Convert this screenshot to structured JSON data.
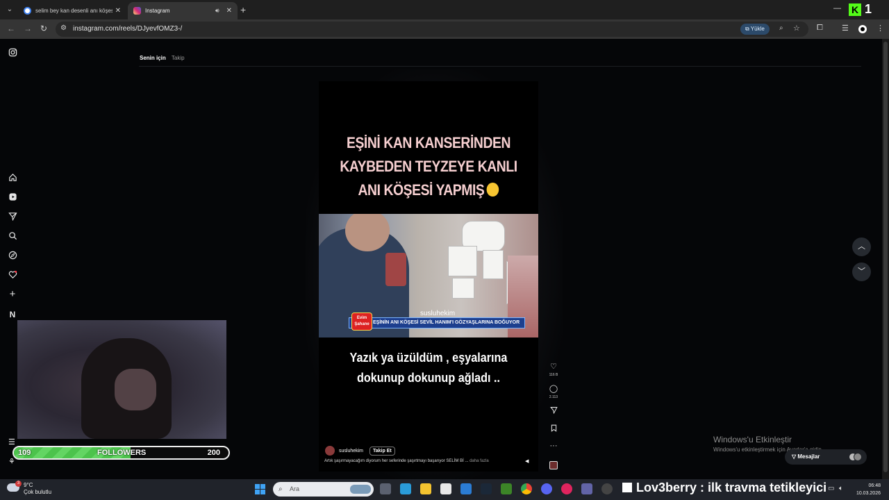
{
  "browser": {
    "tabs": [
      {
        "title": "selim bey kan desenli anı köşesi",
        "favicon_color": "#ffffff",
        "active": false
      },
      {
        "title": "Instagram",
        "favicon_color": "#d62976",
        "active": true
      }
    ],
    "url": "instagram.com/reels/DJyevfOMZ3-/",
    "upload_label": "Yükle",
    "kick_count": "1"
  },
  "feed": {
    "tab_for_you": "Senin için",
    "tab_following": "Takip"
  },
  "reel": {
    "headline_lines": [
      "EŞİNİ KAN KANSERİNDEN",
      "KAYBEDEN TEYZEYE KANLI",
      "ANI KÖŞESİ YAPMIŞ"
    ],
    "video_handle": "susluhekim",
    "evim_badge": "Evim Şahane",
    "lower_third": "EŞİNİN ANI KÖŞESİ SEVİL HANIM'I GÖZYAŞLARINA BOĞUYOR",
    "subtitle_lines": [
      "Yazık ya üzüldüm , eşyalarına",
      "dokunup dokunup ağladı .."
    ],
    "author": "susluhekim",
    "follow_label": "Takip Et",
    "caption": "Artık şaşırmayacağım diyorum her seferinde şaşırtmayı başarıyor SELİM Bİ ...",
    "more_label": "daha fazla",
    "likes": "116 B",
    "comments": "2.113"
  },
  "overlay": {
    "followers_current": "109",
    "followers_label": "FOLLOWERS",
    "followers_goal": "200",
    "followers_progress": 0.545,
    "ticker": "Lov3berry : ilk travma tetikleyici"
  },
  "windows": {
    "activate_title": "Windows'u Etkinleştir",
    "activate_sub": "Windows'u etkinleştirmek için Ayarlar'a gidin.",
    "messages_label": "Mesajlar",
    "weather_temp": "9°C",
    "weather_desc": "Çok bulutlu",
    "weather_badge": "3",
    "search_placeholder": "Ara",
    "time": "06:48",
    "date": "10.03.2026"
  },
  "colors": {
    "accent_green": "#53fc18",
    "follower_bar": "#4cc34c",
    "headline_pink": "#f6cfd0",
    "lower_third_blue": "#1d3f8e"
  }
}
